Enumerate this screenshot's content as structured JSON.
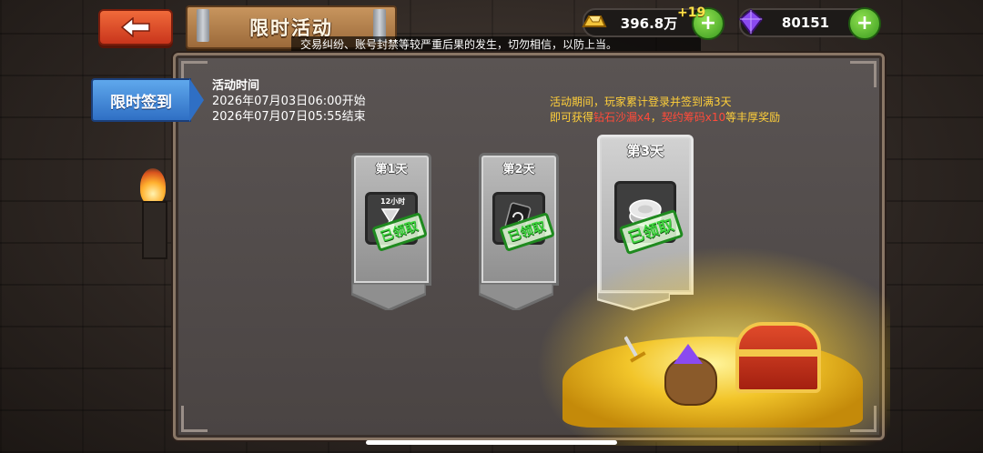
{
  "header": {
    "title": "限时活动",
    "marquee": "交易纠纷、账号封禁等较严重后果的发生，切勿相信，以防上当。"
  },
  "currency": {
    "gold_value": "396.8万",
    "gold_bonus": "+19",
    "gem_value": "80151",
    "plus_label": "+"
  },
  "tabs": [
    {
      "label": "限时签到",
      "active": true
    }
  ],
  "event": {
    "time_heading": "活动时间",
    "start": "2026年07月03日06:00开始",
    "end": "2026年07月07日05:55结束",
    "desc_line1": "活动期间，玩家累计登录并签到满3天",
    "desc_line2_prefix": "即可获得",
    "reward1": "钻石沙漏x4",
    "desc_sep": "，",
    "reward2": "契约筹码x10",
    "desc_line2_suffix": "等丰厚奖励"
  },
  "days": [
    {
      "label": "第1天",
      "item_caption": "12小时",
      "item_icon": "hourglass-icon",
      "status": "已领取"
    },
    {
      "label": "第2天",
      "item_caption": "",
      "item_icon": "refresh-card-icon",
      "status": "已领取"
    },
    {
      "label": "第3天",
      "item_caption": "",
      "item_icon": "chip-icon",
      "status": "已领取"
    }
  ],
  "colors": {
    "accent_blue": "#2f6fc4",
    "reward_red": "#ff4b3a",
    "desc_yellow": "#ffcf3a",
    "claimed_green": "#3cd33c"
  }
}
